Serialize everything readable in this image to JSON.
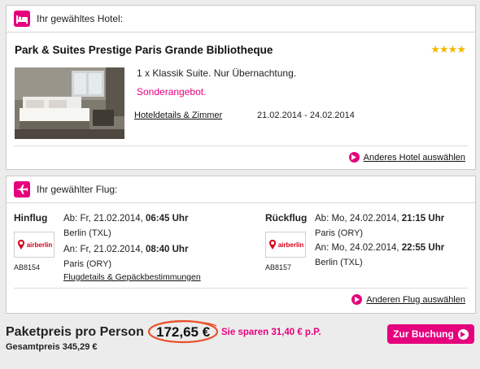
{
  "hotel": {
    "header": "Ihr gewähltes Hotel:",
    "header_icon": "bed-icon",
    "name": "Park & Suites Prestige Paris Grande Bibliotheque",
    "stars": "★★★★",
    "room": "1 x Klassik Suite. Nur Übernachtung.",
    "special": "Sonderangebot.",
    "details_link": "Hoteldetails & Zimmer",
    "dates": "21.02.2014 - 24.02.2014",
    "change_link": "Anderes Hotel auswählen"
  },
  "flight": {
    "header": "Ihr gewählter Flug:",
    "header_icon": "airplane-icon",
    "outbound": {
      "title": "Hinflug",
      "airline": "airberlin",
      "flight_no": "AB8154",
      "dep_prefix": "Ab: Fr, 21.02.2014, ",
      "dep_time": "06:45 Uhr",
      "dep_airport": "Berlin (TXL)",
      "arr_prefix": "An: Fr, 21.02.2014, ",
      "arr_time": "08:40 Uhr",
      "arr_airport": "Paris (ORY)",
      "details_link": "Flugdetails & Gepäckbestimmungen"
    },
    "return": {
      "title": "Rückflug",
      "airline": "airberlin",
      "flight_no": "AB8157",
      "dep_prefix": "Ab: Mo, 24.02.2014, ",
      "dep_time": "21:15 Uhr",
      "dep_airport": "Paris (ORY)",
      "arr_prefix": "An: Mo, 24.02.2014, ",
      "arr_time": "22:55 Uhr",
      "arr_airport": "Berlin (TXL)"
    },
    "change_link": "Anderen Flug auswählen"
  },
  "price": {
    "label": "Paketpreis pro Person",
    "value": "172,65 €",
    "savings": "Sie sparen 31,40 € p.P.",
    "total": "Gesamtpreis 345,29 €",
    "book_button": "Zur Buchung"
  },
  "colors": {
    "accent": "#e5007d",
    "stars": "#f2b800",
    "airline": "#d6001c"
  }
}
